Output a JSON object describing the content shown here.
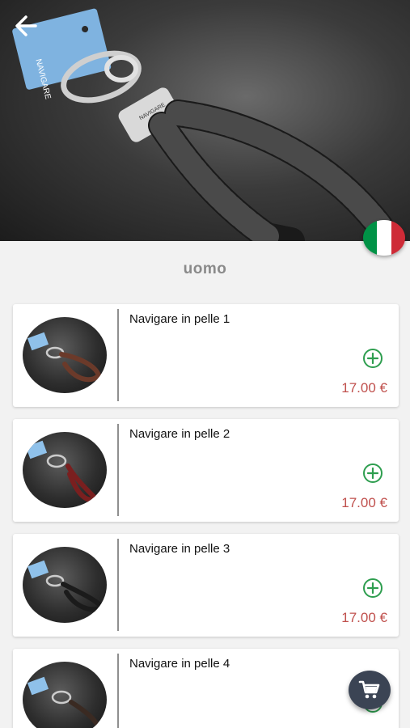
{
  "header": {
    "back_icon": "arrow-left-icon",
    "tag_text": "NAVIGARE",
    "plate_text": "NAVIGARE",
    "language_flag": "italy-flag",
    "flag_colors": [
      "#009246",
      "#ffffff",
      "#ce2b37"
    ]
  },
  "category": {
    "title": "uomo"
  },
  "products": [
    {
      "name": "Navigare in pelle 1",
      "price": "17.00 €"
    },
    {
      "name": "Navigare in pelle 2",
      "price": "17.00 €"
    },
    {
      "name": "Navigare in pelle 3",
      "price": "17.00 €"
    },
    {
      "name": "Navigare in pelle 4",
      "price": ""
    }
  ],
  "colors": {
    "accent_green": "#2e9e4f",
    "price_red": "#c0504d",
    "fab_bg": "#3b4454"
  },
  "cart": {
    "icon": "shopping-cart-icon"
  }
}
